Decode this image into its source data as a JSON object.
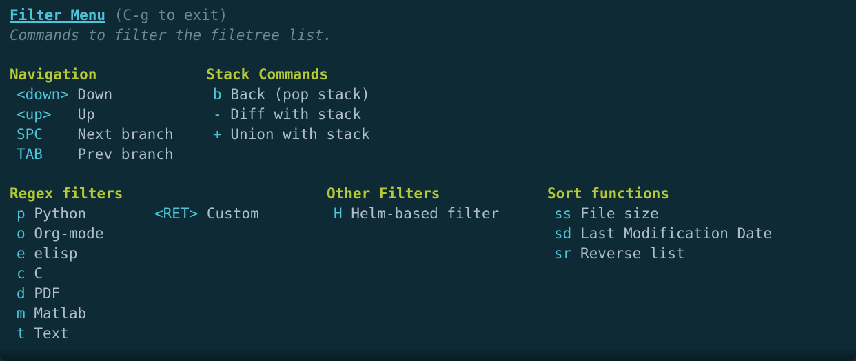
{
  "header": {
    "title": "Filter Menu",
    "exit_hint": "(C-g to exit)",
    "subtitle": "Commands to filter the filetree list."
  },
  "navigation": {
    "title": "Navigation",
    "items": [
      {
        "key": "<down>",
        "pad": " ",
        "desc": "Down"
      },
      {
        "key": "<up>  ",
        "pad": " ",
        "desc": "Up"
      },
      {
        "key": "SPC   ",
        "pad": " ",
        "desc": "Next branch"
      },
      {
        "key": "TAB   ",
        "pad": " ",
        "desc": "Prev branch"
      }
    ]
  },
  "stack": {
    "title": "Stack Commands",
    "items": [
      {
        "key": "b",
        "pad": " ",
        "desc": "Back (pop stack)"
      },
      {
        "key": "-",
        "pad": " ",
        "desc": "Diff with stack"
      },
      {
        "key": "+",
        "pad": " ",
        "desc": "Union with stack"
      }
    ]
  },
  "regex": {
    "title": "Regex filters",
    "items": [
      {
        "key": "p",
        "pad": " ",
        "desc": "Python"
      },
      {
        "key": "o",
        "pad": " ",
        "desc": "Org-mode"
      },
      {
        "key": "e",
        "pad": " ",
        "desc": "elisp"
      },
      {
        "key": "c",
        "pad": " ",
        "desc": "C"
      },
      {
        "key": "d",
        "pad": " ",
        "desc": "PDF"
      },
      {
        "key": "m",
        "pad": " ",
        "desc": "Matlab"
      },
      {
        "key": "t",
        "pad": " ",
        "desc": "Text"
      }
    ]
  },
  "custom": {
    "items": [
      {
        "key": "<RET>",
        "pad": " ",
        "desc": "Custom"
      }
    ]
  },
  "other": {
    "title": "Other Filters",
    "items": [
      {
        "key": "H",
        "pad": " ",
        "desc": "Helm-based filter"
      }
    ]
  },
  "sort": {
    "title": "Sort functions",
    "items": [
      {
        "key": "ss",
        "pad": " ",
        "desc": "File size"
      },
      {
        "key": "sd",
        "pad": " ",
        "desc": "Last Modification Date"
      },
      {
        "key": "sr",
        "pad": " ",
        "desc": "Reverse list"
      }
    ]
  }
}
